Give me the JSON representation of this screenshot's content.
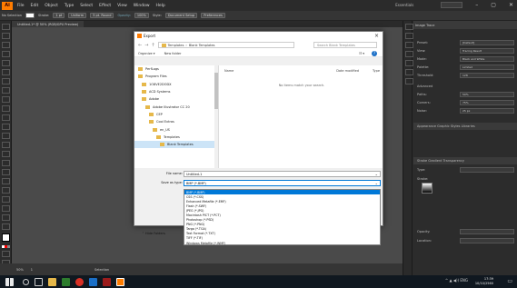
{
  "app": {
    "logo": "Ai",
    "menu": [
      "File",
      "Edit",
      "Object",
      "Type",
      "Select",
      "Effect",
      "View",
      "Window",
      "Help"
    ],
    "workspace": "Essentials"
  },
  "control_bar": {
    "selection": "No Selection",
    "stroke": "Stroke:",
    "uniform": "Uniform",
    "brush": "5 pt. Round",
    "opacity": "Opacity:",
    "opacity_value": "100%",
    "style": "Style:",
    "doc_setup": "Document Setup",
    "preferences": "Preferences"
  },
  "document_tab": "Untitled-1* @ 50% (RGB/GPU Preview)",
  "right_panel": {
    "header": "Image Trace",
    "rows": [
      {
        "label": "Preset:",
        "value": "[Default]"
      },
      {
        "label": "View:",
        "value": "Tracing Result"
      },
      {
        "label": "Mode:",
        "value": "Black and White"
      },
      {
        "label": "Palette:",
        "value": "Limited"
      },
      {
        "label": "Threshold:",
        "value": "128"
      },
      {
        "label": "Advanced",
        "value": ""
      },
      {
        "label": "Paths:",
        "value": "50%"
      },
      {
        "label": "Corners:",
        "value": "75%"
      },
      {
        "label": "Noise:",
        "value": "25 px"
      }
    ],
    "tabs": "Appearance  Graphic Styles  Libraries",
    "stroke_tab": "Stroke  Gradient  Transparency",
    "type_label": "Type:",
    "stroke_label": "Stroke:",
    "opacity_label": "Opacity:",
    "location_label": "Location:"
  },
  "statusbar": {
    "zoom": "50%",
    "artboard": "1",
    "tool": "Selection"
  },
  "dialog": {
    "title": "Export",
    "close": "×",
    "path_parts": [
      "Templates",
      "Blank Templates"
    ],
    "search_placeholder": "Search Blank Templates",
    "organize": "Organize ▾",
    "new_folder": "New folder",
    "tree": [
      "PerfLogs",
      "Program Files",
      "1O8VE2DODX",
      "ACD Systems",
      "Adobe",
      "Adobe Illustrator CC 20",
      "CEP",
      "Cool Extras",
      "en_US",
      "Templates",
      "Blank Templates"
    ],
    "columns": {
      "name": "Name",
      "date": "Date modified",
      "type": "Type"
    },
    "empty_text": "No items match your search.",
    "file_name_label": "File name:",
    "file_name_value": "Untitled-1",
    "save_type_label": "Save as type:",
    "save_type_value": "BMP (*.BMP)",
    "options": [
      "BMP (*.BMP)",
      "CSS (*.CSS)",
      "Enhanced Metafile (*.EMF)",
      "Flash (*.SWF)",
      "JPEG (*.JPG)",
      "Macintosh PICT (*.PCT)",
      "Photoshop (*.PSD)",
      "PNG (*.PNG)",
      "Targa (*.TGA)",
      "Text Format (*.TXT)",
      "TIFF (*.TIF)",
      "Windows Metafile (*.WMF)"
    ],
    "hide_folders": "Hide Folders"
  },
  "taskbar": {
    "time": "17:39",
    "date": "10/10/2560",
    "lang": "ENG"
  },
  "colors": {
    "accent": "#0078d7",
    "ai_orange": "#ff7c00",
    "folder": "#e6b84a"
  }
}
